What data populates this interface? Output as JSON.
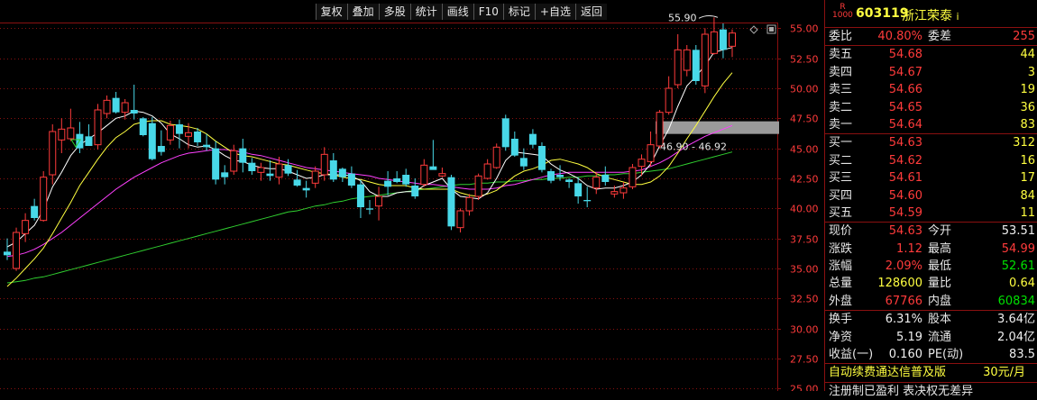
{
  "toolbar": {
    "buttons": [
      "复权",
      "叠加",
      "多股",
      "统计",
      "画线",
      "F10",
      "标记",
      "+自选",
      "返回"
    ]
  },
  "chart_data": {
    "type": "candlestick",
    "y_ticks": [
      "55.00",
      "52.50",
      "50.00",
      "47.50",
      "45.00",
      "42.50",
      "40.00",
      "37.50",
      "35.00",
      "32.50",
      "30.00",
      "27.50",
      "25.00"
    ],
    "ylim": [
      24.8,
      57.2
    ],
    "annotations": {
      "high": "55.90",
      "range": "46.90 - 46.92"
    },
    "colors": {
      "up": "#ff3b3b",
      "down": "#48d8e8",
      "ma5": "#ffffff",
      "ma10": "#ffff40",
      "ma20": "#ff40ff",
      "ma60": "#30d030"
    },
    "candles": [
      {
        "o": 36.4,
        "h": 37.5,
        "l": 35.7,
        "c": 36.1
      },
      {
        "o": 35.0,
        "h": 38.4,
        "l": 34.8,
        "c": 38.0
      },
      {
        "o": 37.9,
        "h": 39.6,
        "l": 37.2,
        "c": 39.0
      },
      {
        "o": 40.2,
        "h": 40.8,
        "l": 39.0,
        "c": 39.2
      },
      {
        "o": 39.0,
        "h": 43.1,
        "l": 38.9,
        "c": 42.6
      },
      {
        "o": 42.8,
        "h": 47.0,
        "l": 42.0,
        "c": 46.4
      },
      {
        "o": 45.7,
        "h": 47.5,
        "l": 44.6,
        "c": 46.6
      },
      {
        "o": 45.8,
        "h": 48.3,
        "l": 45.6,
        "c": 46.7
      },
      {
        "o": 46.2,
        "h": 47.2,
        "l": 44.6,
        "c": 45.0
      },
      {
        "o": 46.0,
        "h": 47.0,
        "l": 45.5,
        "c": 45.2
      },
      {
        "o": 45.3,
        "h": 48.7,
        "l": 44.9,
        "c": 48.2
      },
      {
        "o": 47.9,
        "h": 49.4,
        "l": 47.5,
        "c": 49.0
      },
      {
        "o": 49.2,
        "h": 49.7,
        "l": 47.9,
        "c": 48.0
      },
      {
        "o": 48.0,
        "h": 49.1,
        "l": 47.4,
        "c": 48.8
      },
      {
        "o": 48.2,
        "h": 50.3,
        "l": 47.4,
        "c": 47.9
      },
      {
        "o": 47.5,
        "h": 47.6,
        "l": 46.0,
        "c": 46.1
      },
      {
        "o": 47.1,
        "h": 47.6,
        "l": 44.0,
        "c": 44.1
      },
      {
        "o": 45.2,
        "h": 46.5,
        "l": 44.4,
        "c": 44.7
      },
      {
        "o": 45.7,
        "h": 47.3,
        "l": 45.3,
        "c": 46.9
      },
      {
        "o": 47.0,
        "h": 47.4,
        "l": 45.0,
        "c": 46.2
      },
      {
        "o": 46.0,
        "h": 47.1,
        "l": 45.0,
        "c": 46.3
      },
      {
        "o": 46.4,
        "h": 46.7,
        "l": 45.2,
        "c": 45.5
      },
      {
        "o": 45.3,
        "h": 46.2,
        "l": 44.8,
        "c": 45.1
      },
      {
        "o": 45.0,
        "h": 45.6,
        "l": 42.0,
        "c": 42.4
      },
      {
        "o": 43.0,
        "h": 43.6,
        "l": 42.0,
        "c": 42.6
      },
      {
        "o": 43.1,
        "h": 45.3,
        "l": 42.8,
        "c": 44.8
      },
      {
        "o": 45.0,
        "h": 45.8,
        "l": 43.0,
        "c": 43.8
      },
      {
        "o": 43.8,
        "h": 44.2,
        "l": 42.8,
        "c": 43.1
      },
      {
        "o": 43.0,
        "h": 43.8,
        "l": 42.3,
        "c": 43.4
      },
      {
        "o": 42.9,
        "h": 44.0,
        "l": 42.3,
        "c": 42.7
      },
      {
        "o": 42.6,
        "h": 44.3,
        "l": 42.0,
        "c": 43.7
      },
      {
        "o": 43.6,
        "h": 44.1,
        "l": 42.7,
        "c": 42.9
      },
      {
        "o": 42.4,
        "h": 43.2,
        "l": 41.8,
        "c": 41.9
      },
      {
        "o": 41.7,
        "h": 42.3,
        "l": 40.9,
        "c": 41.5
      },
      {
        "o": 42.1,
        "h": 43.5,
        "l": 41.7,
        "c": 43.1
      },
      {
        "o": 42.8,
        "h": 45.1,
        "l": 42.3,
        "c": 44.5
      },
      {
        "o": 44.0,
        "h": 44.6,
        "l": 42.2,
        "c": 42.4
      },
      {
        "o": 43.3,
        "h": 43.4,
        "l": 42.2,
        "c": 42.6
      },
      {
        "o": 42.9,
        "h": 43.5,
        "l": 41.7,
        "c": 41.9
      },
      {
        "o": 42.0,
        "h": 42.4,
        "l": 39.2,
        "c": 40.1
      },
      {
        "o": 40.0,
        "h": 40.7,
        "l": 39.5,
        "c": 39.9
      },
      {
        "o": 40.2,
        "h": 41.8,
        "l": 39.0,
        "c": 41.0
      },
      {
        "o": 42.3,
        "h": 43.1,
        "l": 41.1,
        "c": 41.8
      },
      {
        "o": 42.5,
        "h": 43.1,
        "l": 42.1,
        "c": 42.2
      },
      {
        "o": 42.8,
        "h": 43.3,
        "l": 41.8,
        "c": 42.0
      },
      {
        "o": 41.9,
        "h": 42.5,
        "l": 40.8,
        "c": 41.0
      },
      {
        "o": 42.0,
        "h": 44.1,
        "l": 41.8,
        "c": 43.6
      },
      {
        "o": 43.5,
        "h": 45.7,
        "l": 43.3,
        "c": 43.2
      },
      {
        "o": 42.7,
        "h": 43.4,
        "l": 42.6,
        "c": 42.9
      },
      {
        "o": 42.6,
        "h": 42.8,
        "l": 38.2,
        "c": 38.5
      },
      {
        "o": 38.4,
        "h": 40.0,
        "l": 38.0,
        "c": 39.8
      },
      {
        "o": 39.8,
        "h": 41.2,
        "l": 39.4,
        "c": 40.9
      },
      {
        "o": 41.0,
        "h": 42.9,
        "l": 40.7,
        "c": 42.7
      },
      {
        "o": 42.5,
        "h": 44.1,
        "l": 42.4,
        "c": 43.7
      },
      {
        "o": 43.4,
        "h": 45.4,
        "l": 43.3,
        "c": 45.1
      },
      {
        "o": 47.5,
        "h": 47.8,
        "l": 44.8,
        "c": 45.1
      },
      {
        "o": 45.8,
        "h": 46.4,
        "l": 44.3,
        "c": 44.4
      },
      {
        "o": 44.2,
        "h": 45.0,
        "l": 43.2,
        "c": 43.5
      },
      {
        "o": 46.2,
        "h": 46.6,
        "l": 45.0,
        "c": 45.3
      },
      {
        "o": 45.2,
        "h": 45.5,
        "l": 43.0,
        "c": 43.2
      },
      {
        "o": 43.1,
        "h": 43.3,
        "l": 42.1,
        "c": 42.3
      },
      {
        "o": 42.8,
        "h": 43.6,
        "l": 42.3,
        "c": 42.6
      },
      {
        "o": 42.4,
        "h": 42.5,
        "l": 41.7,
        "c": 42.2
      },
      {
        "o": 42.1,
        "h": 42.6,
        "l": 40.4,
        "c": 41.0
      },
      {
        "o": 40.7,
        "h": 41.8,
        "l": 40.1,
        "c": 40.6
      },
      {
        "o": 41.7,
        "h": 43.0,
        "l": 41.2,
        "c": 42.6
      },
      {
        "o": 42.8,
        "h": 43.5,
        "l": 41.9,
        "c": 42.2
      },
      {
        "o": 41.2,
        "h": 41.9,
        "l": 40.9,
        "c": 41.4
      },
      {
        "o": 41.3,
        "h": 42.2,
        "l": 40.8,
        "c": 41.7
      },
      {
        "o": 41.8,
        "h": 43.7,
        "l": 41.6,
        "c": 43.4
      },
      {
        "o": 43.5,
        "h": 44.5,
        "l": 42.7,
        "c": 44.1
      },
      {
        "o": 43.9,
        "h": 46.4,
        "l": 43.5,
        "c": 45.3
      },
      {
        "o": 45.2,
        "h": 48.2,
        "l": 45.0,
        "c": 48.0
      },
      {
        "o": 48.0,
        "h": 51.0,
        "l": 47.8,
        "c": 50.0
      },
      {
        "o": 50.3,
        "h": 54.5,
        "l": 50.0,
        "c": 53.2
      },
      {
        "o": 51.5,
        "h": 53.6,
        "l": 51.0,
        "c": 53.2
      },
      {
        "o": 53.2,
        "h": 53.6,
        "l": 50.3,
        "c": 50.6
      },
      {
        "o": 50.2,
        "h": 55.0,
        "l": 49.6,
        "c": 54.5
      },
      {
        "o": 52.9,
        "h": 55.9,
        "l": 52.8,
        "c": 54.7
      },
      {
        "o": 54.9,
        "h": 55.4,
        "l": 52.5,
        "c": 53.2
      },
      {
        "o": 53.5,
        "h": 54.9,
        "l": 52.6,
        "c": 54.6
      }
    ],
    "ma5": [
      36.8,
      37.2,
      37.9,
      38.6,
      39.9,
      41.8,
      43.0,
      44.4,
      45.3,
      45.8,
      46.3,
      46.9,
      47.5,
      47.7,
      48.1,
      48.0,
      47.7,
      47.1,
      46.2,
      45.8,
      45.3,
      45.1,
      45.2,
      44.9,
      44.4,
      44.0,
      43.9,
      43.6,
      43.4,
      43.3,
      43.3,
      43.1,
      42.8,
      42.5,
      42.6,
      42.8,
      42.8,
      42.8,
      42.7,
      42.3,
      41.4,
      41.0,
      41.0,
      41.3,
      41.4,
      41.4,
      41.9,
      42.2,
      42.5,
      41.6,
      41.0,
      40.9,
      40.8,
      41.3,
      42.5,
      44.0,
      44.7,
      44.6,
      44.5,
      44.4,
      43.7,
      43.2,
      42.9,
      42.5,
      41.9,
      41.6,
      41.7,
      41.7,
      41.9,
      42.2,
      42.8,
      43.7,
      45.2,
      46.6,
      48.5,
      50.2,
      51.0,
      51.9,
      53.0,
      53.2,
      53.4
    ],
    "ma10": [
      33.5,
      34.2,
      35.0,
      35.8,
      36.7,
      37.9,
      39.2,
      40.5,
      41.9,
      43.0,
      44.1,
      45.1,
      45.9,
      46.4,
      47.0,
      47.2,
      47.3,
      47.3,
      47.0,
      46.9,
      46.8,
      46.6,
      46.2,
      45.6,
      45.1,
      44.6,
      44.4,
      44.3,
      44.1,
      43.9,
      43.7,
      43.6,
      43.4,
      43.2,
      43.0,
      42.9,
      42.8,
      42.6,
      42.5,
      42.4,
      42.2,
      42.0,
      41.9,
      41.9,
      41.9,
      41.7,
      41.6,
      41.6,
      41.6,
      41.6,
      41.3,
      41.1,
      41.0,
      41.2,
      41.5,
      42.1,
      42.7,
      43.1,
      43.3,
      43.6,
      44.0,
      44.1,
      43.9,
      43.7,
      43.4,
      42.9,
      42.6,
      42.4,
      42.2,
      42.0,
      42.0,
      42.2,
      42.7,
      43.5,
      44.6,
      45.8,
      46.9,
      48.1,
      49.3,
      50.4,
      51.3
    ],
    "ma20": [
      36.0,
      36.1,
      36.3,
      36.6,
      37.0,
      37.5,
      38.0,
      38.6,
      39.2,
      39.8,
      40.4,
      41.0,
      41.6,
      42.1,
      42.6,
      43.0,
      43.4,
      43.8,
      44.1,
      44.4,
      44.6,
      44.7,
      44.8,
      44.9,
      44.9,
      44.8,
      44.7,
      44.5,
      44.4,
      44.2,
      44.0,
      43.8,
      43.6,
      43.4,
      43.3,
      43.2,
      43.1,
      43.0,
      42.9,
      42.8,
      42.7,
      42.5,
      42.4,
      42.3,
      42.2,
      42.1,
      42.0,
      42.0,
      41.9,
      41.8,
      41.7,
      41.6,
      41.6,
      41.6,
      41.7,
      41.9,
      42.0,
      42.2,
      42.4,
      42.6,
      42.8,
      42.9,
      43.0,
      43.0,
      43.0,
      43.0,
      43.0,
      43.0,
      43.0,
      43.1,
      43.2,
      43.5,
      43.8,
      44.2,
      44.7,
      45.2,
      45.6,
      46.0,
      46.3,
      46.6,
      46.9
    ],
    "ma60": [
      33.8,
      33.9,
      34.0,
      34.2,
      34.3,
      34.5,
      34.7,
      34.9,
      35.1,
      35.3,
      35.5,
      35.7,
      35.9,
      36.1,
      36.3,
      36.5,
      36.7,
      36.9,
      37.1,
      37.3,
      37.5,
      37.7,
      37.9,
      38.1,
      38.3,
      38.5,
      38.7,
      38.9,
      39.1,
      39.3,
      39.5,
      39.7,
      39.8,
      40.0,
      40.2,
      40.3,
      40.5,
      40.6,
      40.8,
      40.9,
      41.0,
      41.1,
      41.2,
      41.3,
      41.4,
      41.5,
      41.6,
      41.7,
      41.8,
      41.9,
      42.0,
      42.0,
      42.1,
      42.1,
      42.2,
      42.2,
      42.3,
      42.3,
      42.4,
      42.4,
      42.5,
      42.5,
      42.6,
      42.6,
      42.7,
      42.7,
      42.8,
      42.8,
      42.9,
      42.9,
      43.0,
      43.1,
      43.2,
      43.3,
      43.5,
      43.7,
      43.9,
      44.1,
      44.3,
      44.5,
      44.7
    ]
  },
  "quote": {
    "badge": "R\n1000",
    "code": "603119",
    "name": "浙江荣泰",
    "info_mark": "i",
    "weibi": {
      "label": "委比",
      "value": "40.80%",
      "label2": "委差",
      "value2": "255"
    },
    "sells": [
      {
        "label": "卖五",
        "price": "54.68",
        "vol": "44"
      },
      {
        "label": "卖四",
        "price": "54.67",
        "vol": "3"
      },
      {
        "label": "卖三",
        "price": "54.66",
        "vol": "19"
      },
      {
        "label": "卖二",
        "price": "54.65",
        "vol": "36"
      },
      {
        "label": "卖一",
        "price": "54.64",
        "vol": "83"
      }
    ],
    "buys": [
      {
        "label": "买一",
        "price": "54.63",
        "vol": "312"
      },
      {
        "label": "买二",
        "price": "54.62",
        "vol": "16"
      },
      {
        "label": "买三",
        "price": "54.61",
        "vol": "17"
      },
      {
        "label": "买四",
        "price": "54.60",
        "vol": "84"
      },
      {
        "label": "买五",
        "price": "54.59",
        "vol": "11"
      }
    ],
    "stats": [
      {
        "l1": "现价",
        "v1": "54.63",
        "c1": "red",
        "l2": "今开",
        "v2": "53.51",
        "c2": "white"
      },
      {
        "l1": "涨跌",
        "v1": "1.12",
        "c1": "red",
        "l2": "最高",
        "v2": "54.99",
        "c2": "red"
      },
      {
        "l1": "涨幅",
        "v1": "2.09%",
        "c1": "red",
        "l2": "最低",
        "v2": "52.61",
        "c2": "green"
      },
      {
        "l1": "总量",
        "v1": "128600",
        "c1": "yellow",
        "l2": "量比",
        "v2": "0.64",
        "c2": "yellow"
      },
      {
        "l1": "外盘",
        "v1": "67766",
        "c1": "red",
        "l2": "内盘",
        "v2": "60834",
        "c2": "green"
      }
    ],
    "fund": [
      {
        "l1": "换手",
        "v1": "6.31%",
        "l2": "股本",
        "v2": "3.64亿"
      },
      {
        "l1": "净资",
        "v1": "5.19",
        "l2": "流通",
        "v2": "2.04亿"
      },
      {
        "l1": "收益(一)",
        "v1": "0.160",
        "l2": "PE(动)",
        "v2": "83.5"
      }
    ],
    "promo": {
      "text": "自动续费通达信普及版",
      "price": "30元/月"
    },
    "footer": "注册制已盈利 表决权无差异"
  }
}
